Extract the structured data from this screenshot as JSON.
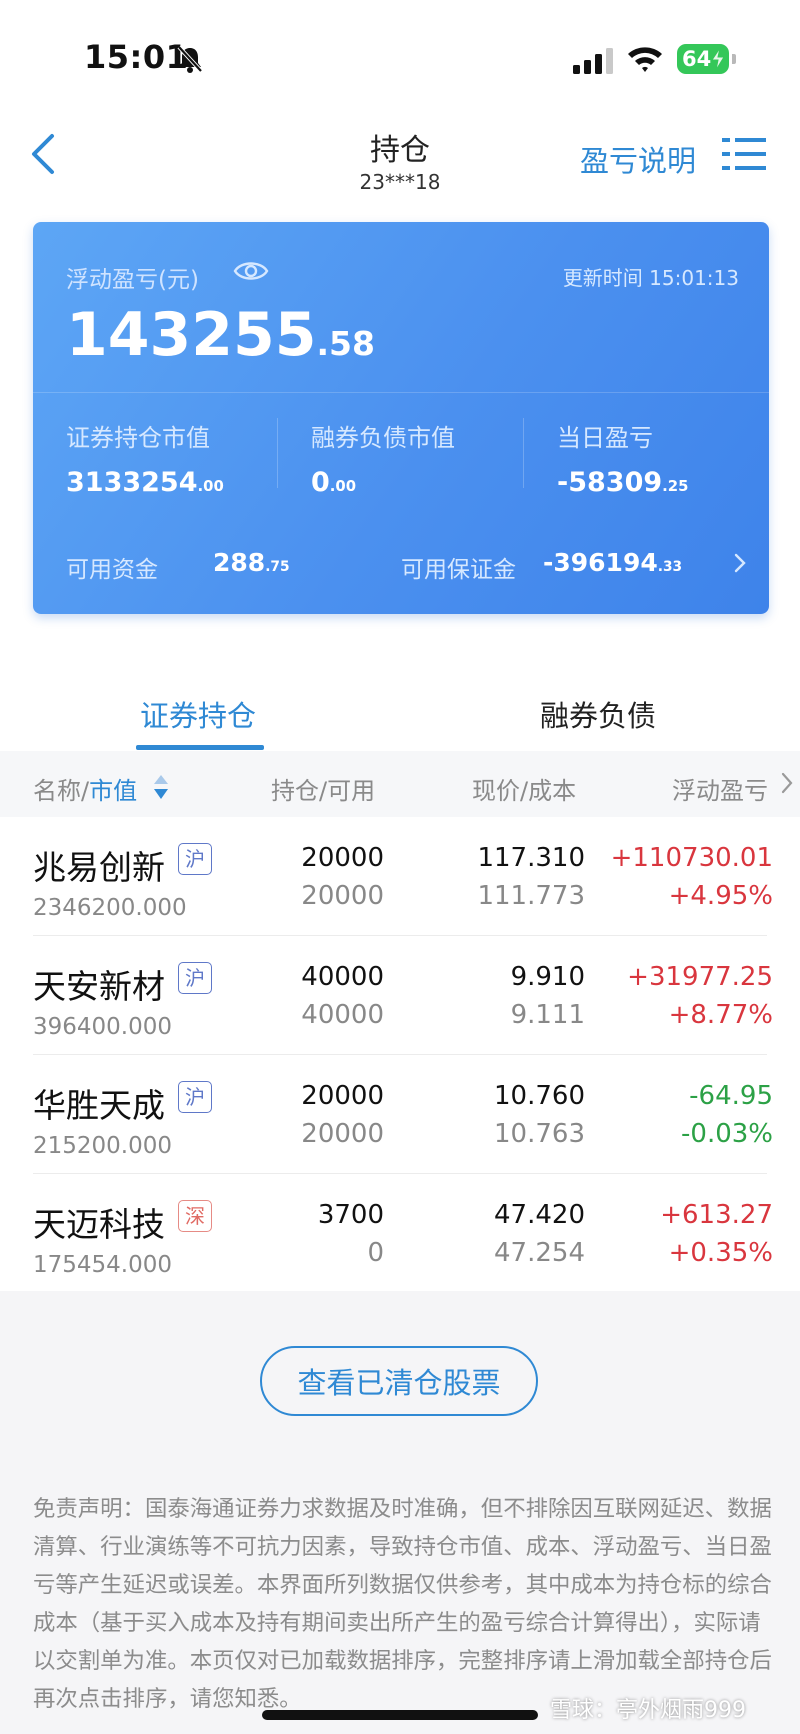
{
  "status": {
    "time": "15:01",
    "battery": "64"
  },
  "nav": {
    "title": "持仓",
    "account": "23***18",
    "explain": "盈亏说明"
  },
  "summary": {
    "float_label": "浮动盈亏(元)",
    "update_time": "更新时间 15:01:13",
    "float_int": "143255",
    "float_dec": ".58",
    "market_label": "证券持仓市值",
    "market_int": "3133254",
    "market_dec": ".00",
    "debt_label": "融券负债市值",
    "debt_int": "0",
    "debt_dec": ".00",
    "daily_label": "当日盈亏",
    "daily_int": "-58309",
    "daily_dec": ".25",
    "avail_label": "可用资金",
    "avail_int": "288",
    "avail_dec": ".75",
    "margin_label": "可用保证金",
    "margin_int": "-396194",
    "margin_dec": ".33"
  },
  "tabs": {
    "holdings": "证券持仓",
    "short_debt": "融券负债"
  },
  "header": {
    "name": "名称/",
    "mv": "市值",
    "hold": "持仓/可用",
    "price": "现价/成本",
    "pl": "浮动盈亏"
  },
  "rows": [
    {
      "name": "兆易创新",
      "market": "沪",
      "mv": "2346200.000",
      "hold": "20000",
      "avail": "20000",
      "price": "117.310",
      "cost": "111.773",
      "pl": "+110730.01",
      "pct": "+4.95%"
    },
    {
      "name": "天安新材",
      "market": "沪",
      "mv": "396400.000",
      "hold": "40000",
      "avail": "40000",
      "price": "9.910",
      "cost": "9.111",
      "pl": "+31977.25",
      "pct": "+8.77%"
    },
    {
      "name": "华胜天成",
      "market": "沪",
      "mv": "215200.000",
      "hold": "20000",
      "avail": "20000",
      "price": "10.760",
      "cost": "10.763",
      "pl": "-64.95",
      "pct": "-0.03%"
    },
    {
      "name": "天迈科技",
      "market": "深",
      "mv": "175454.000",
      "hold": "3700",
      "avail": "0",
      "price": "47.420",
      "cost": "47.254",
      "pl": "+613.27",
      "pct": "+0.35%"
    }
  ],
  "clear_button": "查看已清仓股票",
  "disclaimer": "免责声明：国泰海通证券力求数据及时准确，但不排除因互联网延迟、数据清算、行业演练等不可抗力因素，导致持仓市值、成本、浮动盈亏、当日盈亏等产生延迟或误差。本界面所列数据仅供参考，其中成本为持仓标的综合成本（基于买入成本及持有期间卖出所产生的盈亏综合计算得出），实际请以交割单为准。本页仅对已加载数据排序，完整排序请上滑加载全部持仓后再次点击排序，请您知悉。",
  "watermark": "雪球：亭外烟雨999",
  "colors": {
    "accent": "#2f89d4",
    "up": "#d9363e",
    "down": "#2ca146",
    "card": "#4b90ef"
  }
}
